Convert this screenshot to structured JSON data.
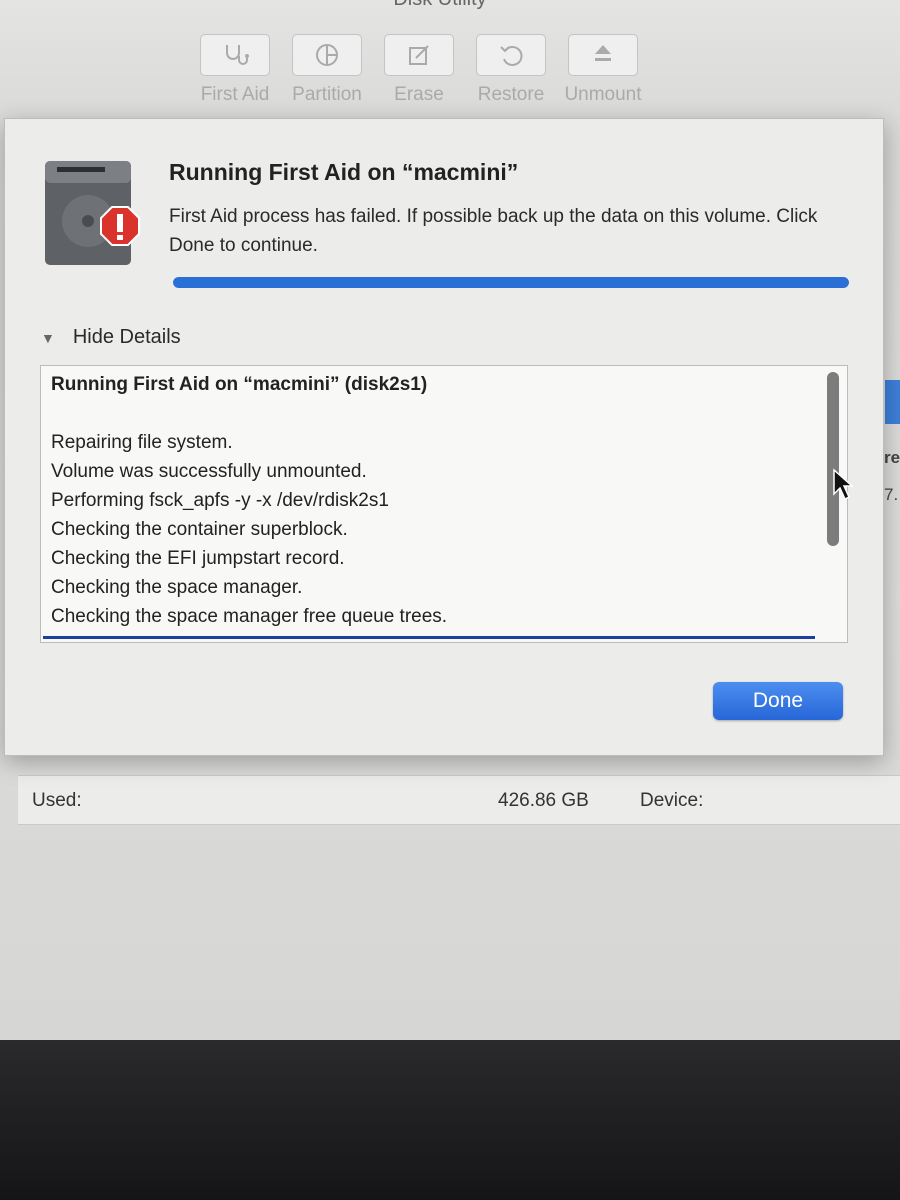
{
  "window": {
    "title": "Disk Utility"
  },
  "toolbar": {
    "buttons": [
      {
        "label": "First Aid",
        "icon": "stethoscope-icon"
      },
      {
        "label": "Partition",
        "icon": "pie-chart-icon"
      },
      {
        "label": "Erase",
        "icon": "erase-icon"
      },
      {
        "label": "Restore",
        "icon": "restore-icon"
      },
      {
        "label": "Unmount",
        "icon": "eject-icon"
      }
    ]
  },
  "dialog": {
    "title": "Running First Aid on “macmini”",
    "message": "First Aid process has failed. If possible back up the data on this volume. Click Done to continue.",
    "progress": 1.0,
    "details_toggle": "Hide Details",
    "log": {
      "header": "Running First Aid on “macmini” (disk2s1)",
      "lines": [
        "Repairing file system.",
        "Volume was successfully unmounted.",
        "Performing fsck_apfs -y -x /dev/rdisk2s1",
        "Checking the container superblock.",
        "Checking the EFI jumpstart record.",
        "Checking the space manager.",
        "Checking the space manager free queue trees."
      ]
    },
    "done_label": "Done",
    "accent_color": "#2a6fd6",
    "alert_color": "#d9332b"
  },
  "info": {
    "used_label": "Used:",
    "used_value": "426.86 GB",
    "device_label": "Device:"
  },
  "sidebar_fragments": [
    "re",
    "7."
  ]
}
